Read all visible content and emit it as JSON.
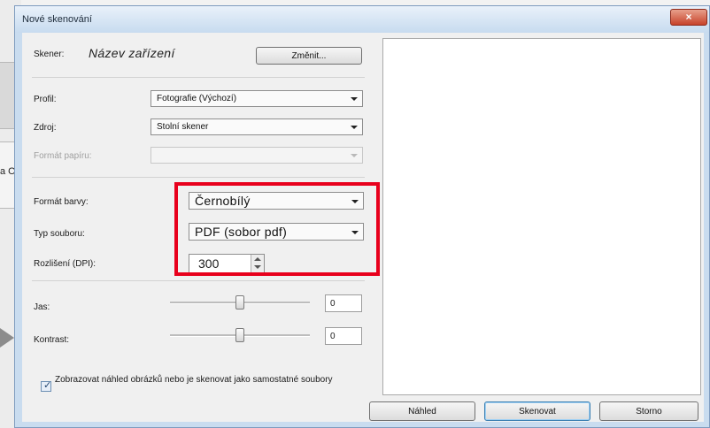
{
  "background": {
    "side_text": "a O"
  },
  "window": {
    "title": "Nové skenování",
    "close_glyph": "×"
  },
  "scanner": {
    "label": "Skener:",
    "device_name": "Název zařízení",
    "change_button": "Změnit..."
  },
  "fields": {
    "profile": {
      "label": "Profil:",
      "value": "Fotografie (Výchozí)"
    },
    "source": {
      "label": "Zdroj:",
      "value": "Stolní skener"
    },
    "paper_format": {
      "label": "Formát papíru:",
      "value": ""
    },
    "color_format": {
      "label": "Formát barvy:",
      "value": "Černobílý"
    },
    "file_type": {
      "label": "Typ souboru:",
      "value": "PDF (sobor pdf)"
    },
    "resolution": {
      "label": "Rozlišení (DPI):",
      "value": "300"
    }
  },
  "adjustments": {
    "brightness": {
      "label": "Jas:",
      "value": "0",
      "slider_fraction": 0.5
    },
    "contrast": {
      "label": "Kontrast:",
      "value": "0",
      "slider_fraction": 0.5
    }
  },
  "preview_checkbox": {
    "checked": true,
    "label": "Zobrazovat náhled obrázků nebo je skenovat jako samostatné soubory"
  },
  "buttons": {
    "preview": "Náhled",
    "scan": "Skenovat",
    "cancel": "Storno"
  },
  "colors": {
    "highlight": "#e8001c",
    "titlebar": "#c7dbef"
  }
}
